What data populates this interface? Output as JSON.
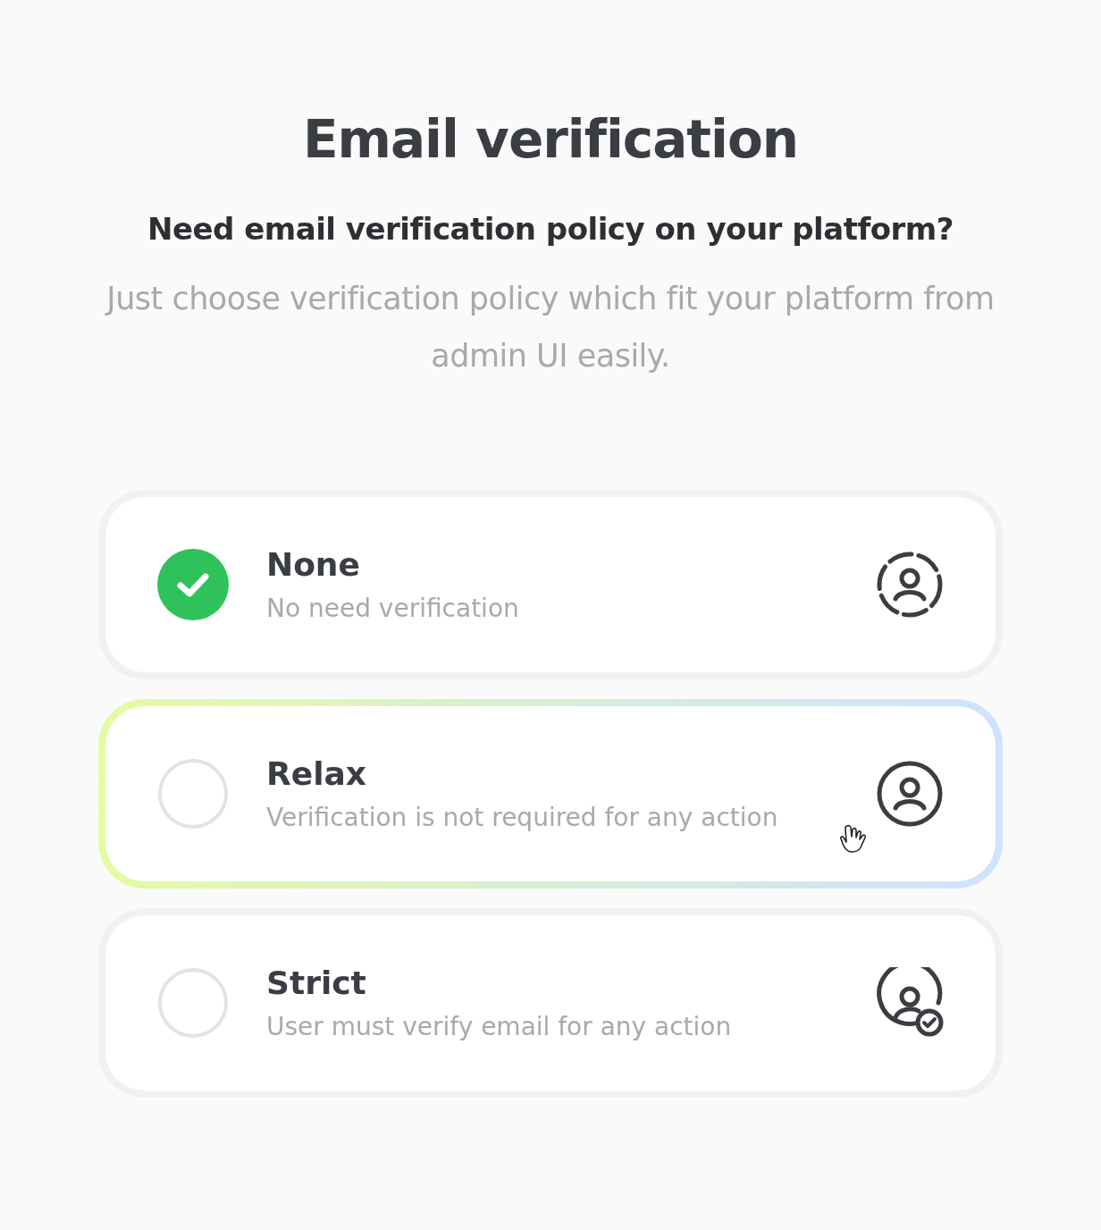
{
  "title": "Email verification",
  "subtitle": "Need email verification policy on your platform?",
  "description": "Just choose verification policy which fit your platform from admin UI easily.",
  "options": [
    {
      "label": "None",
      "description": "No need verification",
      "selected": true,
      "hovered": false,
      "kind": "dashed-user"
    },
    {
      "label": "Relax",
      "description": "Verification is not required for any action",
      "selected": false,
      "hovered": true,
      "kind": "user"
    },
    {
      "label": "Strict",
      "description": "User must verify email for any action",
      "selected": false,
      "hovered": false,
      "kind": "user-check"
    }
  ]
}
